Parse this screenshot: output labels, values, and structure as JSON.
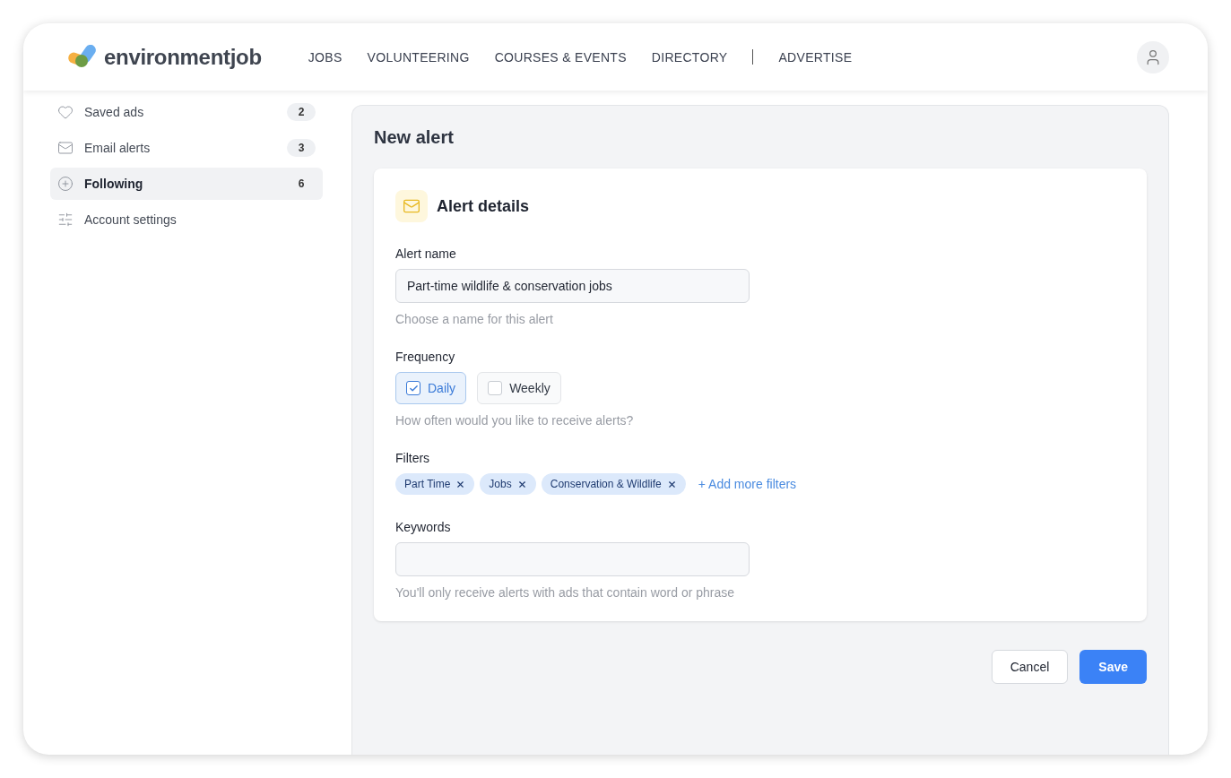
{
  "header": {
    "logo": "environmentjob",
    "nav": [
      "JOBS",
      "VOLUNTEERING",
      "COURSES & EVENTS",
      "DIRECTORY"
    ],
    "nav_secondary": [
      "ADVERTISE"
    ]
  },
  "sidebar": {
    "items": [
      {
        "label": "Saved ads",
        "count": "2",
        "selected": false
      },
      {
        "label": "Email alerts",
        "count": "3",
        "selected": false
      },
      {
        "label": "Following",
        "count": "6",
        "selected": true
      },
      {
        "label": "Account settings",
        "selected": false
      }
    ]
  },
  "page_title": "New alert",
  "card": {
    "title": "Alert details",
    "alert_name": {
      "label": "Alert name",
      "value": "Part-time wildlife & conservation jobs",
      "hint": "Choose a name for this alert"
    },
    "frequency": {
      "label": "Frequency",
      "options": [
        {
          "label": "Daily",
          "selected": true
        },
        {
          "label": "Weekly",
          "selected": false
        }
      ],
      "hint": "How often would you like to receive alerts?"
    },
    "filters": {
      "label": "Filters",
      "chips": [
        "Part Time",
        "Jobs",
        "Conservation & Wildlife"
      ],
      "add_link": "+ Add more filters"
    },
    "keywords": {
      "label": "Keywords",
      "hint": "You'll only receive alerts with ads that contain word or phrase"
    }
  },
  "buttons": {
    "cancel": "Cancel",
    "save": "Save"
  }
}
